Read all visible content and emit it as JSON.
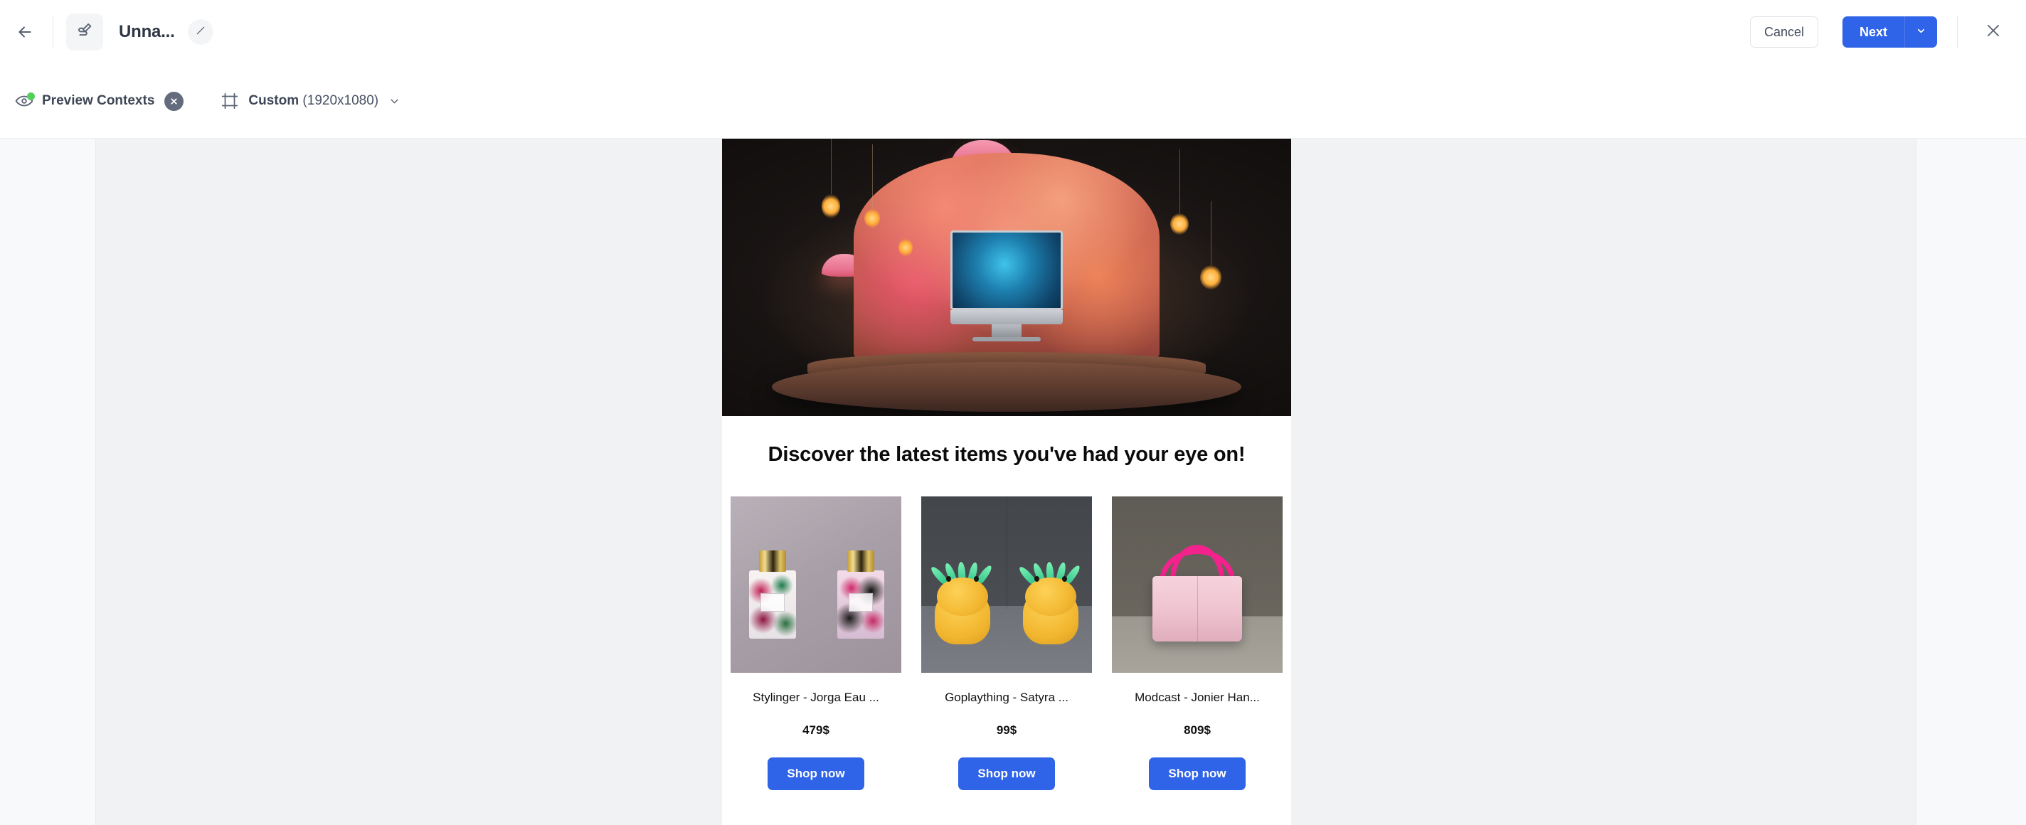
{
  "header": {
    "back_icon": "arrow-left-icon",
    "journey_icon": "journey-edit-icon",
    "title": "Unna...",
    "edit_icon": "pencil-icon",
    "cancel_label": "Cancel",
    "next_label": "Next",
    "next_caret_icon": "chevron-down-icon",
    "close_icon": "close-icon",
    "accent_color": "#2f63e8"
  },
  "toolbar": {
    "preview_icon": "eye-icon",
    "preview_badge_color": "#52d05a",
    "preview_label": "Preview Contexts",
    "clear_icon": "close-circle-icon",
    "frame_icon": "artboard-icon",
    "size_name": "Custom",
    "size_dimensions": "(1920x1080)",
    "size_caret_icon": "chevron-down-icon"
  },
  "email": {
    "hero_image_alt": "3d-shopping-display-with-imac",
    "headline": "Discover the latest items you've had your eye on!",
    "products": [
      {
        "image_alt": "two-floral-perfume-bottles",
        "name": "Stylinger - Jorga Eau ...",
        "price": "479$",
        "cta": "Shop now"
      },
      {
        "image_alt": "two-yellow-pineapple-plush-toys",
        "name": "Goplaything - Satyra ...",
        "price": "99$",
        "cta": "Shop now"
      },
      {
        "image_alt": "pink-handbag-with-magenta-handles",
        "name": "Modcast - Jonier Han...",
        "price": "809$",
        "cta": "Shop now"
      }
    ],
    "button_color": "#2f63e8"
  }
}
